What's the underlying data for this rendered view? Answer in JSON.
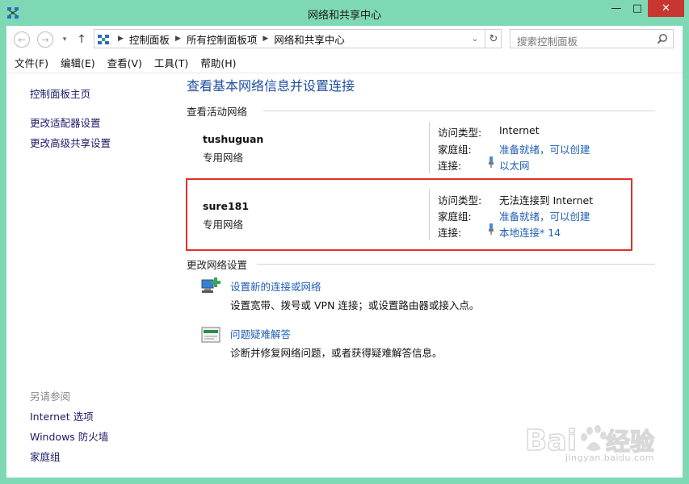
{
  "window": {
    "title": "网络和共享中心"
  },
  "controls": {
    "minimize": "—",
    "maximize": "□",
    "close": "✕"
  },
  "address": {
    "crumbs": [
      "控制面板",
      "所有控制面板项",
      "网络和共享中心"
    ],
    "search_placeholder": "搜索控制面板"
  },
  "menu": [
    "文件(F)",
    "编辑(E)",
    "查看(V)",
    "工具(T)",
    "帮助(H)"
  ],
  "sidebar": {
    "links": [
      "控制面板主页",
      "更改适配器设置",
      "更改高级共享设置"
    ],
    "see_also_heading": "另请参阅",
    "see_also": [
      "Internet 选项",
      "Windows 防火墙",
      "家庭组"
    ]
  },
  "main": {
    "title": "查看基本网络信息并设置连接",
    "active_heading": "查看活动网络",
    "networks": [
      {
        "name": "tushuguan",
        "type": "专用网络",
        "access_label": "访问类型:",
        "access_value": "Internet",
        "homegroup_label": "家庭组:",
        "homegroup_value": "准备就绪，可以创建",
        "connection_label": "连接:",
        "connection_value": "以太网"
      },
      {
        "name": "sure181",
        "type": "专用网络",
        "access_label": "访问类型:",
        "access_value": "无法连接到 Internet",
        "homegroup_label": "家庭组:",
        "homegroup_value": "准备就绪，可以创建",
        "connection_label": "连接:",
        "connection_value": "本地连接* 14"
      }
    ],
    "change_heading": "更改网络设置",
    "tasks": [
      {
        "link": "设置新的连接或网络",
        "desc": "设置宽带、拨号或 VPN 连接；或设置路由器或接入点。"
      },
      {
        "link": "问题疑难解答",
        "desc": "诊断并修复网络问题，或者获得疑难解答信息。"
      }
    ]
  },
  "watermark": {
    "text": "jingyan.baidu.com"
  },
  "colors": {
    "frame": "#7fd8b4",
    "link": "#1e5fb4",
    "title": "#1e4e9e",
    "highlight": "#e0302c",
    "close": "#c7372f"
  }
}
